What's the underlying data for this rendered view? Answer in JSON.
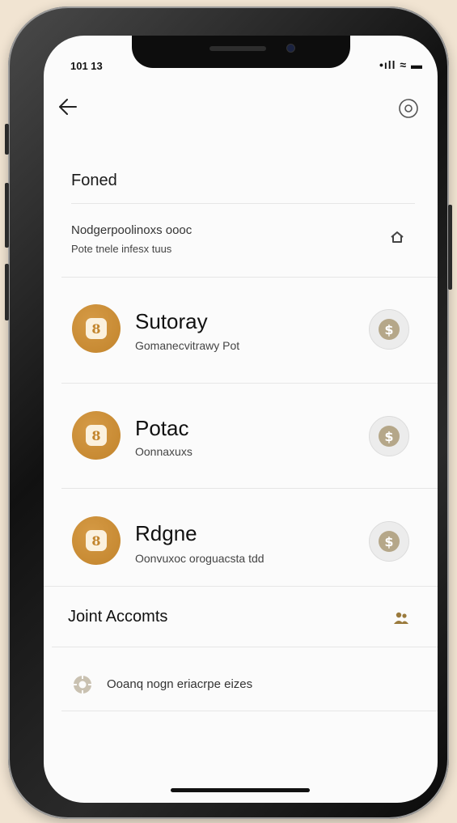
{
  "status": {
    "time": "101 13",
    "icons": "•ıll ≈ ▬"
  },
  "header": {
    "title": "Foned"
  },
  "notice": {
    "line1": "Nodgerpoolinoxs oooc",
    "line2": "Pote tnele infesx tuus"
  },
  "accounts": [
    {
      "name": "Sutoray",
      "subtitle": "Gomanecvitrawy Pot",
      "avatar_glyph": "8",
      "action_glyph": "$"
    },
    {
      "name": "Potac",
      "subtitle": "Oonnaxuxs",
      "avatar_glyph": "8",
      "action_glyph": "$"
    },
    {
      "name": "Rdgne",
      "subtitle": "Oonvuxoc oroguacsta tdd",
      "avatar_glyph": "8",
      "action_glyph": "$"
    }
  ],
  "joint": {
    "title": "Joint Accomts"
  },
  "option": {
    "label": "Ooanq nogn eriacrpe eizes"
  },
  "colors": {
    "accent": "#c2842c",
    "background": "#f1e4d2",
    "screen": "#fbfbfb"
  }
}
